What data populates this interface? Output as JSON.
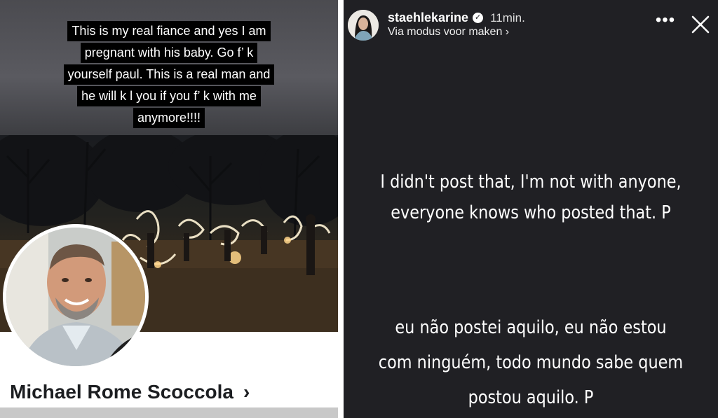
{
  "left_post": {
    "caption_lines": [
      "This is my real fiance and yes I am",
      "pregnant with his baby. Go f’ k",
      "yourself paul.  This is a real man and",
      "he will k l you if you f’ k with me",
      "anymore!!!!"
    ],
    "profile_name": "Michael Rome Scoccola",
    "chevron": "›"
  },
  "story": {
    "username": "staehlekarine",
    "verified_icon": "check-badge-icon",
    "time": "11min.",
    "subline": "Via modus voor maken ›",
    "more_icon": "•••",
    "close_icon": "close-icon",
    "text_en_lines": [
      "I didn't post that, I'm not with anyone,",
      "everyone knows who posted that. P"
    ],
    "text_pt_lines": [
      "eu não postei aquilo, eu não estou",
      "com ninguém, todo mundo sabe quem",
      "postou aquilo. P"
    ]
  },
  "colors": {
    "story_bg": "#202024",
    "caption_bg": "#000000",
    "profile_name": "#1c1e21"
  }
}
